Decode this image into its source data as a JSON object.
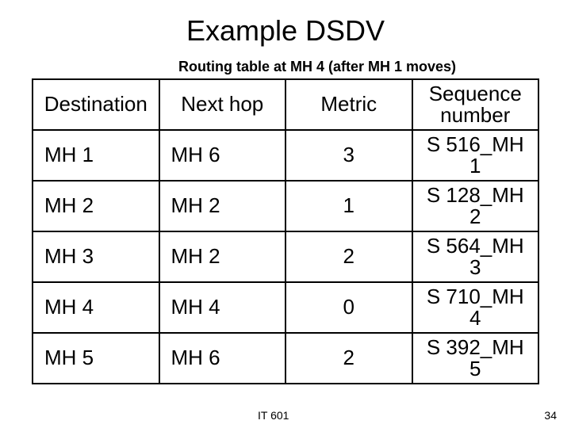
{
  "title": "Example DSDV",
  "subtitle": "Routing table at MH 4 (after MH 1 moves)",
  "columns": [
    "Destination",
    "Next hop",
    "Metric",
    "Sequence number"
  ],
  "rows": [
    {
      "dest": "MH 1",
      "next": "MH 6",
      "metric": "3",
      "seq": "S 516_MH 1"
    },
    {
      "dest": "MH 2",
      "next": "MH 2",
      "metric": "1",
      "seq": "S 128_MH 2"
    },
    {
      "dest": "MH 3",
      "next": "MH 2",
      "metric": "2",
      "seq": "S 564_MH 3"
    },
    {
      "dest": "MH 4",
      "next": "MH 4",
      "metric": "0",
      "seq": "S 710_MH 4"
    },
    {
      "dest": "MH 5",
      "next": "MH 6",
      "metric": "2",
      "seq": "S 392_MH 5"
    }
  ],
  "footer": {
    "course": "IT 601",
    "page": "34"
  },
  "chart_data": {
    "type": "table",
    "title": "Routing table at MH 4 (after MH 1 moves)",
    "columns": [
      "Destination",
      "Next hop",
      "Metric",
      "Sequence number"
    ],
    "rows": [
      [
        "MH 1",
        "MH 6",
        3,
        "S 516_MH 1"
      ],
      [
        "MH 2",
        "MH 2",
        1,
        "S 128_MH 2"
      ],
      [
        "MH 3",
        "MH 2",
        2,
        "S 564_MH 3"
      ],
      [
        "MH 4",
        "MH 4",
        0,
        "S 710_MH 4"
      ],
      [
        "MH 5",
        "MH 6",
        2,
        "S 392_MH 5"
      ]
    ]
  }
}
